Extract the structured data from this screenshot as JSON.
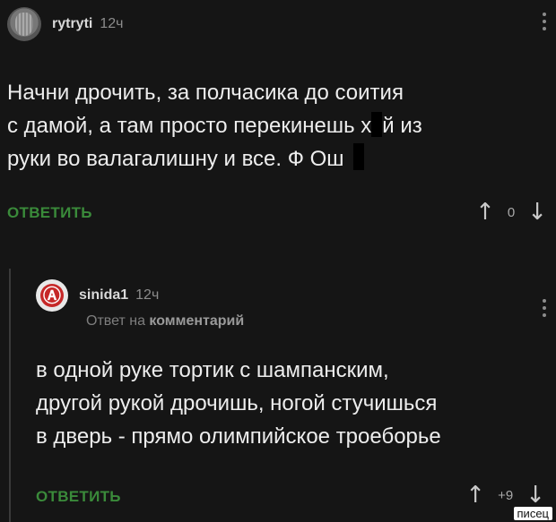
{
  "comments": [
    {
      "username": "rytryti",
      "time": "12ч",
      "text_line1": "Начни дрочить, за полчасика до соития",
      "text_line2a": "с дамой, а там просто перекинешь х",
      "text_line2b": "й из",
      "text_line3": "руки во валагалишну и все. Ф Ош",
      "reply_label": "ОТВЕТИТЬ",
      "score": "0"
    },
    {
      "username": "sinida1",
      "time": "12ч",
      "reply_prefix": "Ответ на",
      "reply_target": "комментарий",
      "text": "в одной руке тортик с шампанским,\nдругой рукой дрочишь, ногой стучишься\nв дверь - прямо олимпийское троеборье",
      "reply_label": "ОТВЕТИТЬ",
      "score": "+9"
    }
  ],
  "icons": {
    "upvote": "↑",
    "downvote": "↓"
  },
  "watermark": "писец",
  "colors": {
    "background": "#151515",
    "reply_green": "#3a8a3a",
    "text": "#ededed"
  }
}
